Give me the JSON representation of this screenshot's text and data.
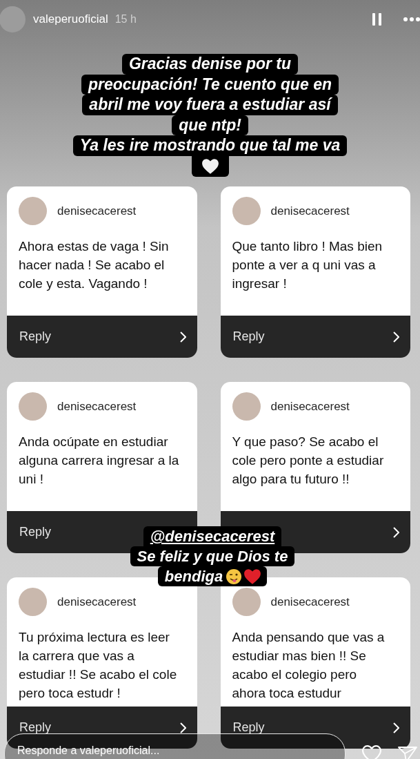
{
  "header": {
    "username": "valeperuoficial",
    "time": "15 h"
  },
  "caption": {
    "lines": [
      "Gracias denise por tu",
      "preocupación! Te cuento que en",
      "abril me voy fuera a estudiar así",
      "que ntp!",
      "Ya les ire mostrando que tal me va"
    ]
  },
  "questions": [
    {
      "username": "denisecacerest",
      "text": "Ahora estas de vaga ! Sin hacer nada ! Se acabo el cole y esta. Vagando !",
      "reply": "Reply",
      "arrow_visible": true
    },
    {
      "username": "denisecacerest",
      "text": "Que tanto libro ! Mas bien ponte a ver a q uni vas a ingresar !",
      "reply": "Reply",
      "arrow_visible": true
    },
    {
      "username": "denisecacerest",
      "text": "Anda ocúpate en estudiar alguna carrera ingresar a la uni !",
      "reply": "Reply",
      "arrow_visible": false
    },
    {
      "username": "denisecacerest",
      "text": "Y que paso? Se acabo el cole pero ponte a estudiar algo para tu futuro !!",
      "arrow_visible": true
    },
    {
      "username": "denisecacerest",
      "text": "Tu próxima lectura es leer la carrera que vas a estudiar !! Se acabo el cole pero toca estudr !",
      "reply": "Reply",
      "arrow_visible": true
    },
    {
      "username": "denisecacerest",
      "text": "Anda pensando que vas a estudiar mas bien !! Se acabo el colegio pero ahora toca estudur",
      "reply": "Reply",
      "arrow_visible": true
    }
  ],
  "sticker": {
    "mention": "@denisecacerest",
    "lines": [
      "Se feliz y que Dios te",
      "bendiga"
    ]
  },
  "message_field": {
    "placeholder": "Responde a valeperuoficial..."
  }
}
